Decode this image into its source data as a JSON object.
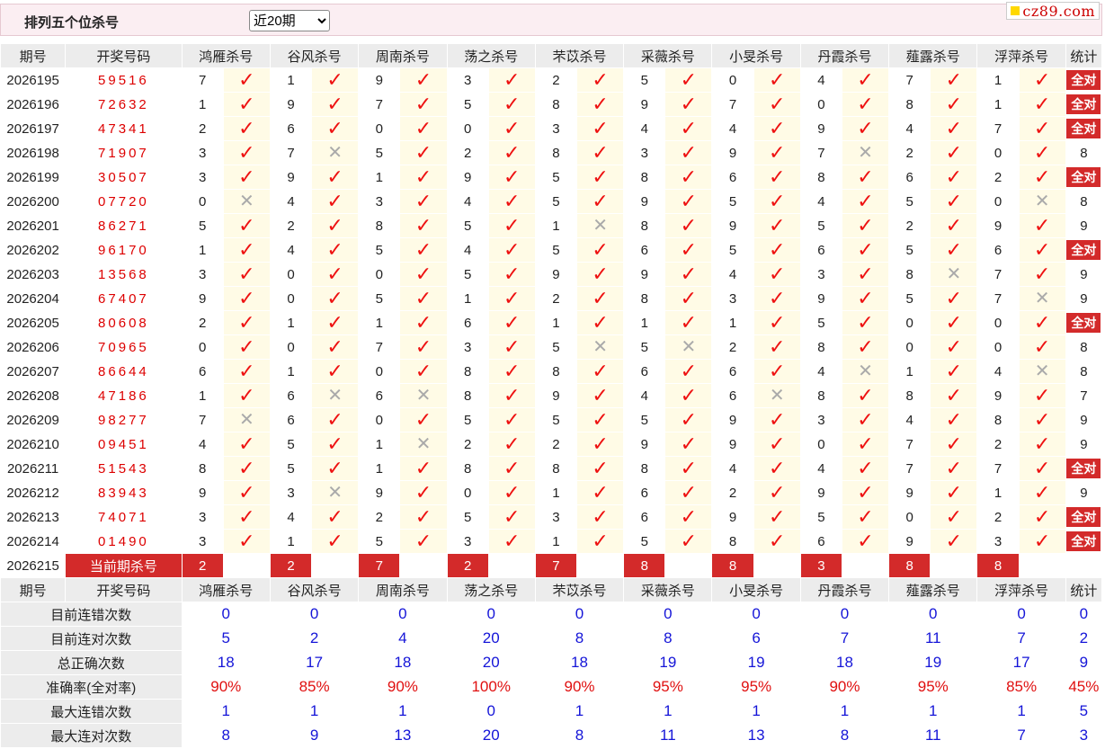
{
  "header": {
    "title": "排列五个位杀号",
    "filter_value": "近20期",
    "filter_options": [
      "近20期"
    ],
    "logo": "cz89.com"
  },
  "columns": {
    "period": "期号",
    "draw": "开奖号码",
    "experts": [
      "鸿雁杀号",
      "谷风杀号",
      "周南杀号",
      "荡之杀号",
      "芣苡杀号",
      "采薇杀号",
      "小旻杀号",
      "丹霞杀号",
      "薤露杀号",
      "浮萍杀号"
    ],
    "stat": "统计"
  },
  "all_correct_label": "全对",
  "rows": [
    {
      "period": "2026195",
      "draw": "59516",
      "kills": [
        "7",
        "1",
        "9",
        "3",
        "2",
        "5",
        "0",
        "4",
        "7",
        "1"
      ],
      "hits": [
        1,
        1,
        1,
        1,
        1,
        1,
        1,
        1,
        1,
        1
      ],
      "stat": "全对"
    },
    {
      "period": "2026196",
      "draw": "72632",
      "kills": [
        "1",
        "9",
        "7",
        "5",
        "8",
        "9",
        "7",
        "0",
        "8",
        "1"
      ],
      "hits": [
        1,
        1,
        1,
        1,
        1,
        1,
        1,
        1,
        1,
        1
      ],
      "stat": "全对"
    },
    {
      "period": "2026197",
      "draw": "47341",
      "kills": [
        "2",
        "6",
        "0",
        "0",
        "3",
        "4",
        "4",
        "9",
        "4",
        "7"
      ],
      "hits": [
        1,
        1,
        1,
        1,
        1,
        1,
        1,
        1,
        1,
        1
      ],
      "stat": "全对"
    },
    {
      "period": "2026198",
      "draw": "71907",
      "kills": [
        "3",
        "7",
        "5",
        "2",
        "8",
        "3",
        "9",
        "7",
        "2",
        "0"
      ],
      "hits": [
        1,
        0,
        1,
        1,
        1,
        1,
        1,
        0,
        1,
        1
      ],
      "stat": "8"
    },
    {
      "period": "2026199",
      "draw": "30507",
      "kills": [
        "3",
        "9",
        "1",
        "9",
        "5",
        "8",
        "6",
        "8",
        "6",
        "2"
      ],
      "hits": [
        1,
        1,
        1,
        1,
        1,
        1,
        1,
        1,
        1,
        1
      ],
      "stat": "全对"
    },
    {
      "period": "2026200",
      "draw": "07720",
      "kills": [
        "0",
        "4",
        "3",
        "4",
        "5",
        "9",
        "5",
        "4",
        "5",
        "0"
      ],
      "hits": [
        0,
        1,
        1,
        1,
        1,
        1,
        1,
        1,
        1,
        0
      ],
      "stat": "8"
    },
    {
      "period": "2026201",
      "draw": "86271",
      "kills": [
        "5",
        "2",
        "8",
        "5",
        "1",
        "8",
        "9",
        "5",
        "2",
        "9"
      ],
      "hits": [
        1,
        1,
        1,
        1,
        0,
        1,
        1,
        1,
        1,
        1
      ],
      "stat": "9"
    },
    {
      "period": "2026202",
      "draw": "96170",
      "kills": [
        "1",
        "4",
        "5",
        "4",
        "5",
        "6",
        "5",
        "6",
        "5",
        "6"
      ],
      "hits": [
        1,
        1,
        1,
        1,
        1,
        1,
        1,
        1,
        1,
        1
      ],
      "stat": "全对"
    },
    {
      "period": "2026203",
      "draw": "13568",
      "kills": [
        "3",
        "0",
        "0",
        "5",
        "9",
        "9",
        "4",
        "3",
        "8",
        "7"
      ],
      "hits": [
        1,
        1,
        1,
        1,
        1,
        1,
        1,
        1,
        0,
        1
      ],
      "stat": "9"
    },
    {
      "period": "2026204",
      "draw": "67407",
      "kills": [
        "9",
        "0",
        "5",
        "1",
        "2",
        "8",
        "3",
        "9",
        "5",
        "7"
      ],
      "hits": [
        1,
        1,
        1,
        1,
        1,
        1,
        1,
        1,
        1,
        0
      ],
      "stat": "9"
    },
    {
      "period": "2026205",
      "draw": "80608",
      "kills": [
        "2",
        "1",
        "1",
        "6",
        "1",
        "1",
        "1",
        "5",
        "0",
        "0"
      ],
      "hits": [
        1,
        1,
        1,
        1,
        1,
        1,
        1,
        1,
        1,
        1
      ],
      "stat": "全对"
    },
    {
      "period": "2026206",
      "draw": "70965",
      "kills": [
        "0",
        "0",
        "7",
        "3",
        "5",
        "5",
        "2",
        "8",
        "0",
        "0"
      ],
      "hits": [
        1,
        1,
        1,
        1,
        0,
        0,
        1,
        1,
        1,
        1
      ],
      "stat": "8"
    },
    {
      "period": "2026207",
      "draw": "86644",
      "kills": [
        "6",
        "1",
        "0",
        "8",
        "8",
        "6",
        "6",
        "4",
        "1",
        "4"
      ],
      "hits": [
        1,
        1,
        1,
        1,
        1,
        1,
        1,
        0,
        1,
        0
      ],
      "stat": "8"
    },
    {
      "period": "2026208",
      "draw": "47186",
      "kills": [
        "1",
        "6",
        "6",
        "8",
        "9",
        "4",
        "6",
        "8",
        "8",
        "9"
      ],
      "hits": [
        1,
        0,
        0,
        1,
        1,
        1,
        0,
        1,
        1,
        1
      ],
      "stat": "7"
    },
    {
      "period": "2026209",
      "draw": "98277",
      "kills": [
        "7",
        "6",
        "0",
        "5",
        "5",
        "5",
        "9",
        "3",
        "4",
        "8"
      ],
      "hits": [
        0,
        1,
        1,
        1,
        1,
        1,
        1,
        1,
        1,
        1
      ],
      "stat": "9"
    },
    {
      "period": "2026210",
      "draw": "09451",
      "kills": [
        "4",
        "5",
        "1",
        "2",
        "2",
        "9",
        "9",
        "0",
        "7",
        "2"
      ],
      "hits": [
        1,
        1,
        0,
        1,
        1,
        1,
        1,
        1,
        1,
        1
      ],
      "stat": "9"
    },
    {
      "period": "2026211",
      "draw": "51543",
      "kills": [
        "8",
        "5",
        "1",
        "8",
        "8",
        "8",
        "4",
        "4",
        "7",
        "7"
      ],
      "hits": [
        1,
        1,
        1,
        1,
        1,
        1,
        1,
        1,
        1,
        1
      ],
      "stat": "全对"
    },
    {
      "period": "2026212",
      "draw": "83943",
      "kills": [
        "9",
        "3",
        "9",
        "0",
        "1",
        "6",
        "2",
        "9",
        "9",
        "1"
      ],
      "hits": [
        1,
        0,
        1,
        1,
        1,
        1,
        1,
        1,
        1,
        1
      ],
      "stat": "9"
    },
    {
      "period": "2026213",
      "draw": "74071",
      "kills": [
        "3",
        "4",
        "2",
        "5",
        "3",
        "6",
        "9",
        "5",
        "0",
        "2"
      ],
      "hits": [
        1,
        1,
        1,
        1,
        1,
        1,
        1,
        1,
        1,
        1
      ],
      "stat": "全对"
    },
    {
      "period": "2026214",
      "draw": "01490",
      "kills": [
        "3",
        "1",
        "5",
        "3",
        "1",
        "5",
        "8",
        "6",
        "9",
        "3"
      ],
      "hits": [
        1,
        1,
        1,
        1,
        1,
        1,
        1,
        1,
        1,
        1
      ],
      "stat": "全对"
    }
  ],
  "current": {
    "period": "2026215",
    "label": "当前期杀号",
    "kills": [
      "2",
      "2",
      "7",
      "2",
      "7",
      "8",
      "8",
      "3",
      "8",
      "8"
    ]
  },
  "stats": [
    {
      "label": "目前连错次数",
      "values": [
        "0",
        "0",
        "0",
        "0",
        "0",
        "0",
        "0",
        "0",
        "0",
        "0"
      ],
      "total": "0",
      "color": "blue"
    },
    {
      "label": "目前连对次数",
      "values": [
        "5",
        "2",
        "4",
        "20",
        "8",
        "8",
        "6",
        "7",
        "11",
        "7"
      ],
      "total": "2",
      "color": "blue"
    },
    {
      "label": "总正确次数",
      "values": [
        "18",
        "17",
        "18",
        "20",
        "18",
        "19",
        "19",
        "18",
        "19",
        "17"
      ],
      "total": "9",
      "color": "blue"
    },
    {
      "label": "准确率(全对率)",
      "values": [
        "90%",
        "85%",
        "90%",
        "100%",
        "90%",
        "95%",
        "95%",
        "90%",
        "95%",
        "85%"
      ],
      "total": "45%",
      "color": "red"
    },
    {
      "label": "最大连错次数",
      "values": [
        "1",
        "1",
        "1",
        "0",
        "1",
        "1",
        "1",
        "1",
        "1",
        "1"
      ],
      "total": "5",
      "color": "blue"
    },
    {
      "label": "最大连对次数",
      "values": [
        "8",
        "9",
        "13",
        "20",
        "8",
        "11",
        "13",
        "8",
        "11",
        "7"
      ],
      "total": "3",
      "color": "blue"
    }
  ],
  "colors": {
    "accent_red": "#d32a2a",
    "header_bg": "#ececec",
    "mark_bg": "#fffbe6",
    "stat_blue": "#1515d8",
    "stat_red": "#e01010"
  }
}
